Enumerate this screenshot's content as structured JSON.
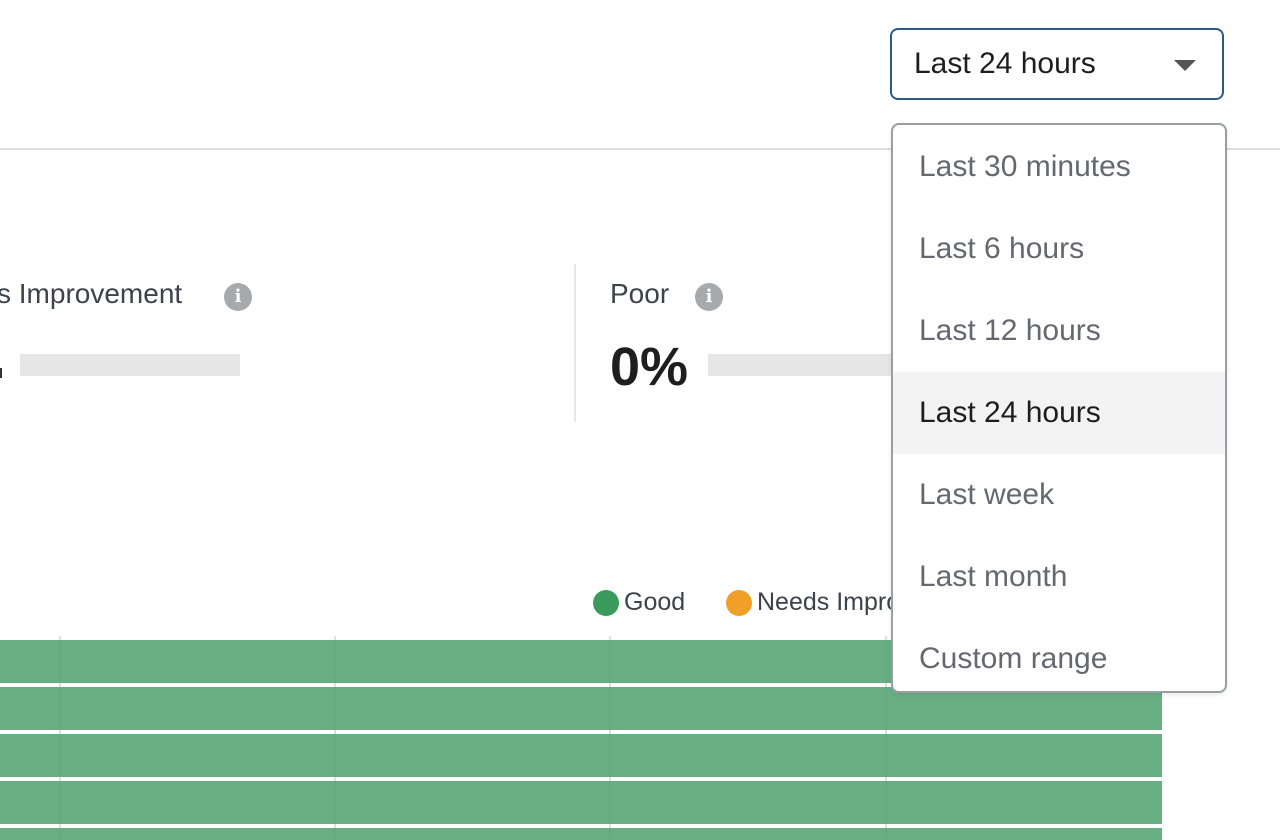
{
  "range_select": {
    "value": "Last 24 hours",
    "options": [
      "Last 30 minutes",
      "Last 6 hours",
      "Last 12 hours",
      "Last 24 hours",
      "Last week",
      "Last month",
      "Custom range"
    ],
    "selected_index": 3
  },
  "stats": {
    "needs_improvement": {
      "label": "s Improvement"
    },
    "poor": {
      "label": "Poor",
      "value": "0%",
      "fill_fraction": 0
    }
  },
  "legend": [
    {
      "label": "Good",
      "color": "#3a9b5c"
    },
    {
      "label": "Needs Impro",
      "color": "#f0a029"
    }
  ],
  "chart": {
    "bar_color": "#6aaf84",
    "gridline_color": "#5c9e74",
    "visible_bar_count": 5
  },
  "icons": {
    "info": "i"
  }
}
